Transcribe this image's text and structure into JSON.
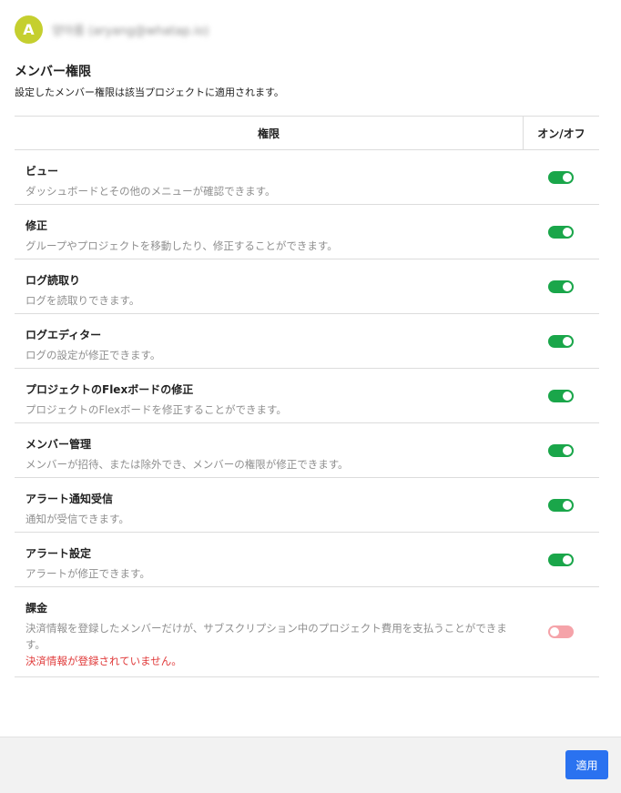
{
  "header": {
    "avatar_letter": "A",
    "user_name": "양아름 (aryang@whatap.io)"
  },
  "section": {
    "title": "メンバー権限",
    "description": "設定したメンバー権限は該当プロジェクトに適用されます。"
  },
  "table": {
    "headers": {
      "permission": "権限",
      "toggle": "オン/オフ"
    },
    "rows": [
      {
        "title": "ビュー",
        "description": "ダッシュボードとその他のメニューが確認できます。",
        "enabled": true
      },
      {
        "title": "修正",
        "description": "グループやプロジェクトを移動したり、修正することができます。",
        "enabled": true
      },
      {
        "title": "ログ読取り",
        "description": "ログを読取りできます。",
        "enabled": true
      },
      {
        "title": "ログエディター",
        "description": "ログの設定が修正できます。",
        "enabled": true
      },
      {
        "title": "プロジェクトのFlexボードの修正",
        "description": "プロジェクトのFlexボードを修正することができます。",
        "enabled": true
      },
      {
        "title": "メンバー管理",
        "description": "メンバーが招待、または除外でき、メンバーの権限が修正できます。",
        "enabled": true
      },
      {
        "title": "アラート通知受信",
        "description": "通知が受信できます。",
        "enabled": true
      },
      {
        "title": "アラート設定",
        "description": "アラートが修正できます。",
        "enabled": true
      },
      {
        "title": "課金",
        "description": "決済情報を登録したメンバーだけが、サブスクリプション中のプロジェクト費用を支払うことができます。",
        "warning": "決済情報が登録されていません。",
        "enabled": false
      }
    ]
  },
  "footer": {
    "apply_label": "適用"
  },
  "colors": {
    "toggle_on": "#1aa64a",
    "toggle_off": "#f5a3a9",
    "apply_button": "#2a72f0",
    "warning": "#e03a3a",
    "avatar": "#c5cf2f"
  }
}
